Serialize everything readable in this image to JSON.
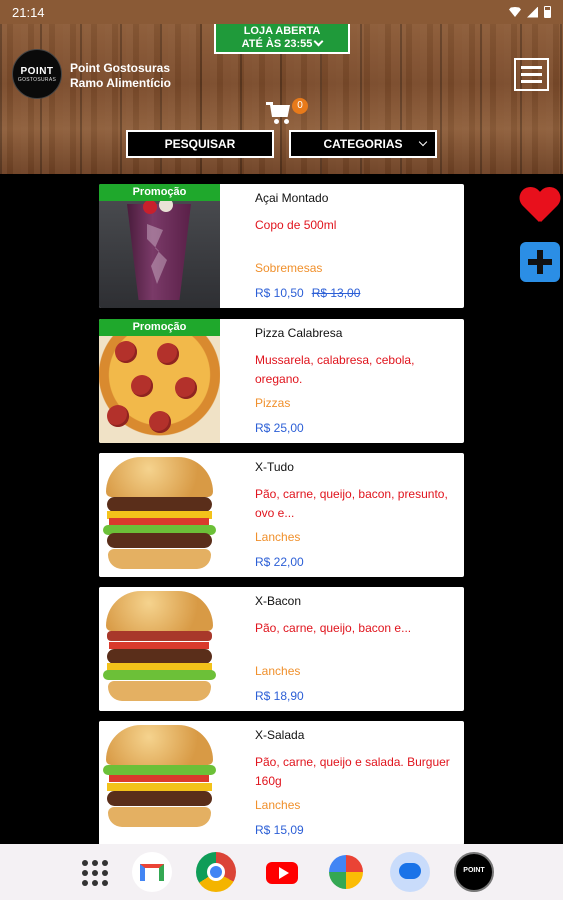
{
  "status_bar": {
    "time": "21:14"
  },
  "header": {
    "store_status_line1": "LOJA ABERTA",
    "store_status_line2": "ATÉ ÀS 23:55",
    "logo_text": "POINT",
    "logo_subtext": "GOSTOSURAS",
    "store_name": "Point Gostosuras",
    "store_segment": "Ramo Alimentício",
    "cart_count": "0",
    "search_label": "PESQUISAR",
    "categories_label": "CATEGORIAS"
  },
  "products": [
    {
      "promo": "Promoção",
      "name": "Açai Montado",
      "description": "Copo de 500ml",
      "category": "Sobremesas",
      "price": "R$ 10,50",
      "old_price": "R$ 13,00",
      "image": "acai"
    },
    {
      "promo": "Promoção",
      "name": "Pizza Calabresa",
      "description": "Mussarela, calabresa, cebola, oregano.",
      "category": "Pizzas",
      "price": "R$ 25,00",
      "image": "pizza"
    },
    {
      "name": "X-Tudo",
      "description": "Pão, carne, queijo, bacon, presunto, ovo e...",
      "category": "Lanches",
      "price": "R$ 22,00",
      "image": "burger"
    },
    {
      "name": "X-Bacon",
      "description": "Pão, carne, queijo, bacon e...",
      "category": "Lanches",
      "price": "R$ 18,90",
      "image": "burger"
    },
    {
      "name": "X-Salada",
      "description": "Pão, carne, queijo e salada. Burguer 160g",
      "category": "Lanches",
      "price": "R$ 15,09",
      "image": "burger"
    }
  ],
  "floating_actions": [
    "favorites-heart-icon",
    "add-plus-icon"
  ],
  "dock": {
    "apps": [
      "apps-grid-icon",
      "gmail-icon",
      "chrome-icon",
      "youtube-icon",
      "photos-icon",
      "messages-icon",
      "point-app-icon"
    ],
    "point_app_label": "POINT"
  },
  "colors": {
    "promo_green": "#1fa82c",
    "description_red": "#e0141d",
    "category_orange": "#f0902c",
    "price_blue": "#2c5fd6",
    "badge_green": "#1f9a3a",
    "cart_badge_orange": "#e87a1a"
  }
}
